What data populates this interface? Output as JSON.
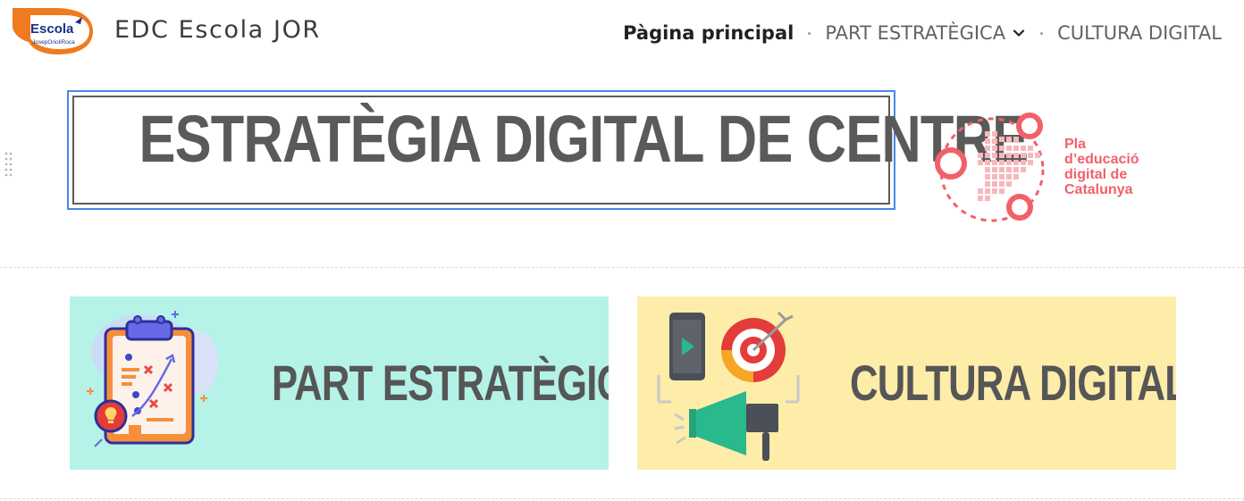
{
  "header": {
    "logo_text": "Escola",
    "logo_subtext": "JosepOrioliRoca",
    "site_title": "EDC Escola JOR",
    "nav": [
      {
        "label": "Pàgina principal",
        "active": true
      },
      {
        "label": "PART ESTRATÈGICA",
        "has_dropdown": true
      },
      {
        "label": "CULTURA DIGITAL"
      }
    ]
  },
  "banner": {
    "title": "ESTRATÈGIA DIGITAL DE CENTRE"
  },
  "pla_logo": {
    "lines": [
      "Pla",
      "d’educació",
      "digital de",
      "Catalunya"
    ],
    "color": "#f26068"
  },
  "cards": [
    {
      "label": "PART ESTRATÈGICA",
      "bg": "#b5f2e7"
    },
    {
      "label": "CULTURA DIGITAL",
      "bg": "#fdeda9"
    }
  ],
  "colors": {
    "accent_border": "#4a86e8",
    "brand_orange": "#f07a1f"
  }
}
